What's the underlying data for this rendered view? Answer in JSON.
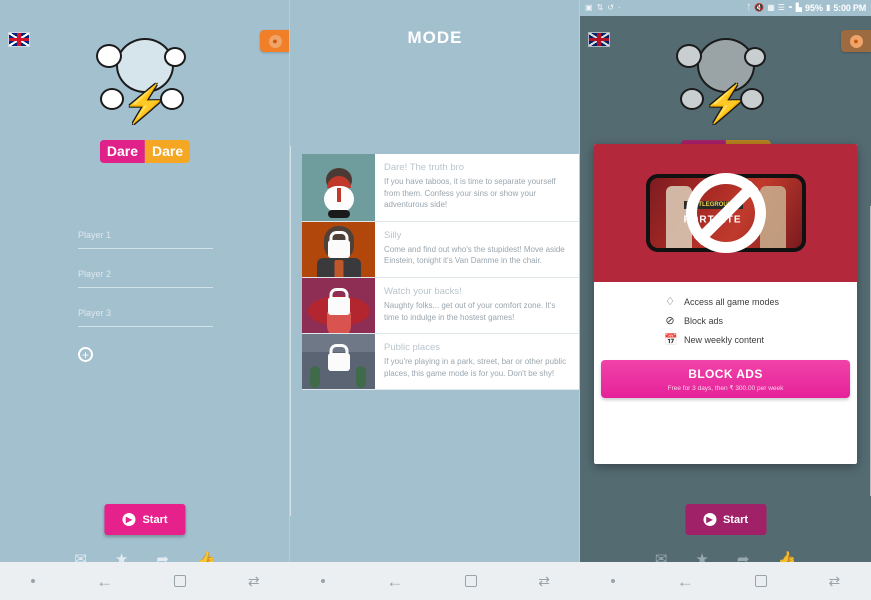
{
  "app": {
    "brand_part1": "Dare",
    "brand_part2": "Dare",
    "accent_pink": "#e0218a",
    "accent_orange": "#f5a623",
    "background": "#a3c0cf"
  },
  "statusbar": {
    "time": "5:00 PM",
    "battery": "95%",
    "icons": [
      "screenshot-icon",
      "sync-icon",
      "rotate-icon",
      "bluetooth-icon",
      "mute-icon",
      "sd-icon",
      "vibrate-icon",
      "wifi-icon",
      "signal-icon"
    ]
  },
  "screen_setup": {
    "language_flag": "uk-flag",
    "fire_button_label": "🔥",
    "players": [
      {
        "placeholder": "Player 1",
        "value": ""
      },
      {
        "placeholder": "Player 2",
        "value": ""
      },
      {
        "placeholder": "Player 3",
        "value": ""
      }
    ],
    "add_player_label": "+",
    "start_label": "Start",
    "footer_icons": [
      "mail-icon",
      "star-icon",
      "share-icon",
      "thumbs-up-icon"
    ]
  },
  "screen_mode": {
    "title": "MODE",
    "cards": [
      {
        "title": "Dare! The truth bro",
        "description": "If you have taboos, it is time to separate yourself from them. Confess your sins or show your adventurous side!",
        "locked": false,
        "thumb": "mascot-thumb"
      },
      {
        "title": "Silly",
        "description": "Come and find out who's the stupidest! Move aside Einstein, tonight it's Van Damme in the chair.",
        "locked": true,
        "thumb": "shouting-man-thumb"
      },
      {
        "title": "Watch your backs!",
        "description": "Naughty folks... get out of your comfort zone. It's time to indulge in the hostest games!",
        "locked": true,
        "thumb": "lips-thumb"
      },
      {
        "title": "Public places",
        "description": "If you're playing in a park, street, bar or other public places, this game mode is for you. Don't be shy!",
        "locked": true,
        "thumb": "street-thumb"
      }
    ]
  },
  "screen_paywall": {
    "promo": {
      "image_name": "blocked-ads-banner",
      "game_title_small": "BATTLEGROUNDS",
      "game_title_large": "FORTNITE",
      "overlay_icon": "no-ads-icon"
    },
    "features": [
      {
        "icon": "diamond-icon",
        "label": "Access all game modes"
      },
      {
        "icon": "block-icon",
        "label": "Block ads"
      },
      {
        "icon": "calendar-icon",
        "label": "New weekly content"
      }
    ],
    "cta_label": "BLOCK ADS",
    "cta_sub": "Free for 3 days, then ₹ 300.00 per week",
    "start_label": "Start"
  },
  "navbar": {
    "segments": [
      {
        "dot": "•",
        "back": "←",
        "home": "home-square-icon",
        "recents": "⇄"
      },
      {
        "dot": "•",
        "back": "←",
        "home": "home-square-icon",
        "recents": "⇄"
      },
      {
        "dot": "•",
        "back": "←",
        "home": "home-square-icon",
        "recents": "⇄"
      }
    ]
  }
}
